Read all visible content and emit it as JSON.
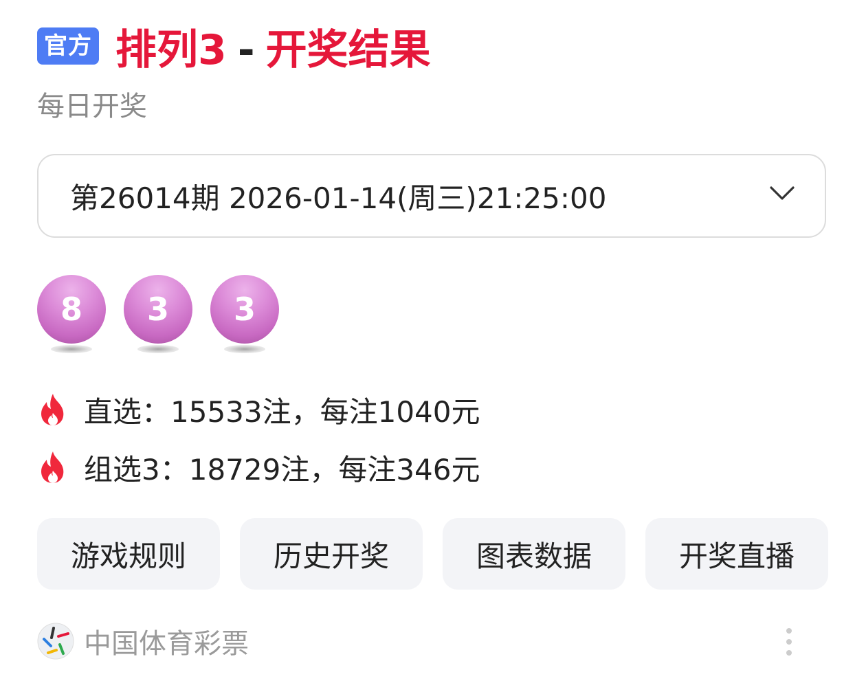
{
  "header": {
    "badge": "官方",
    "title_game": "排列3",
    "title_separator": "-",
    "title_suffix": "开奖结果",
    "subtitle": "每日开奖"
  },
  "issue_select": {
    "value": "第26014期 2026-01-14(周三)21:25:00"
  },
  "balls": [
    "8",
    "3",
    "3"
  ],
  "prizes": [
    {
      "icon": "fire-icon",
      "text": "直选：15533注，每注1040元"
    },
    {
      "icon": "fire-icon",
      "text": "组选3：18729注，每注346元"
    }
  ],
  "actions": [
    "游戏规则",
    "历史开奖",
    "图表数据",
    "开奖直播"
  ],
  "source": {
    "name": "中国体育彩票"
  },
  "colors": {
    "title_red": "#e5173a",
    "badge_blue": "#4e7cf4",
    "ball_purple": "#d283cf",
    "fire_red": "#f0283c"
  }
}
